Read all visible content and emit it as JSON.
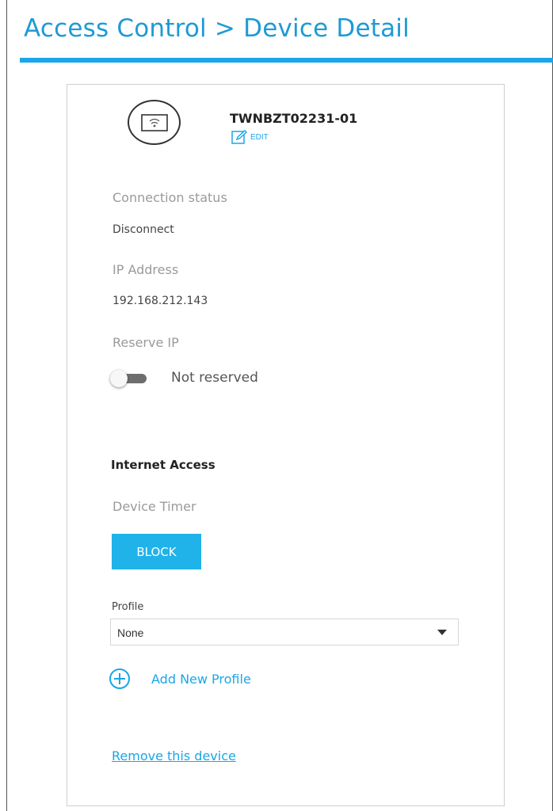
{
  "header": {
    "title": "Access Control > Device Detail"
  },
  "device": {
    "name": "TWNBZT02231-01",
    "edit_label": "EDIT",
    "icon": "wifi-device-icon"
  },
  "fields": {
    "connection_status_label": "Connection status",
    "connection_status_value": "Disconnect",
    "ip_address_label": "IP Address",
    "ip_address_value": "192.168.212.143",
    "reserve_ip_label": "Reserve IP",
    "reserve_ip_state": "Not reserved",
    "reserve_ip_on": false
  },
  "internet_access": {
    "title": "Internet Access",
    "device_timer_label": "Device Timer",
    "block_button": "BLOCK",
    "profile_label": "Profile",
    "profile_value": "None",
    "add_profile": "Add New Profile"
  },
  "footer": {
    "remove_device": "Remove this device"
  },
  "colors": {
    "accent": "#1aa6e8",
    "button": "#1fb3ea"
  }
}
